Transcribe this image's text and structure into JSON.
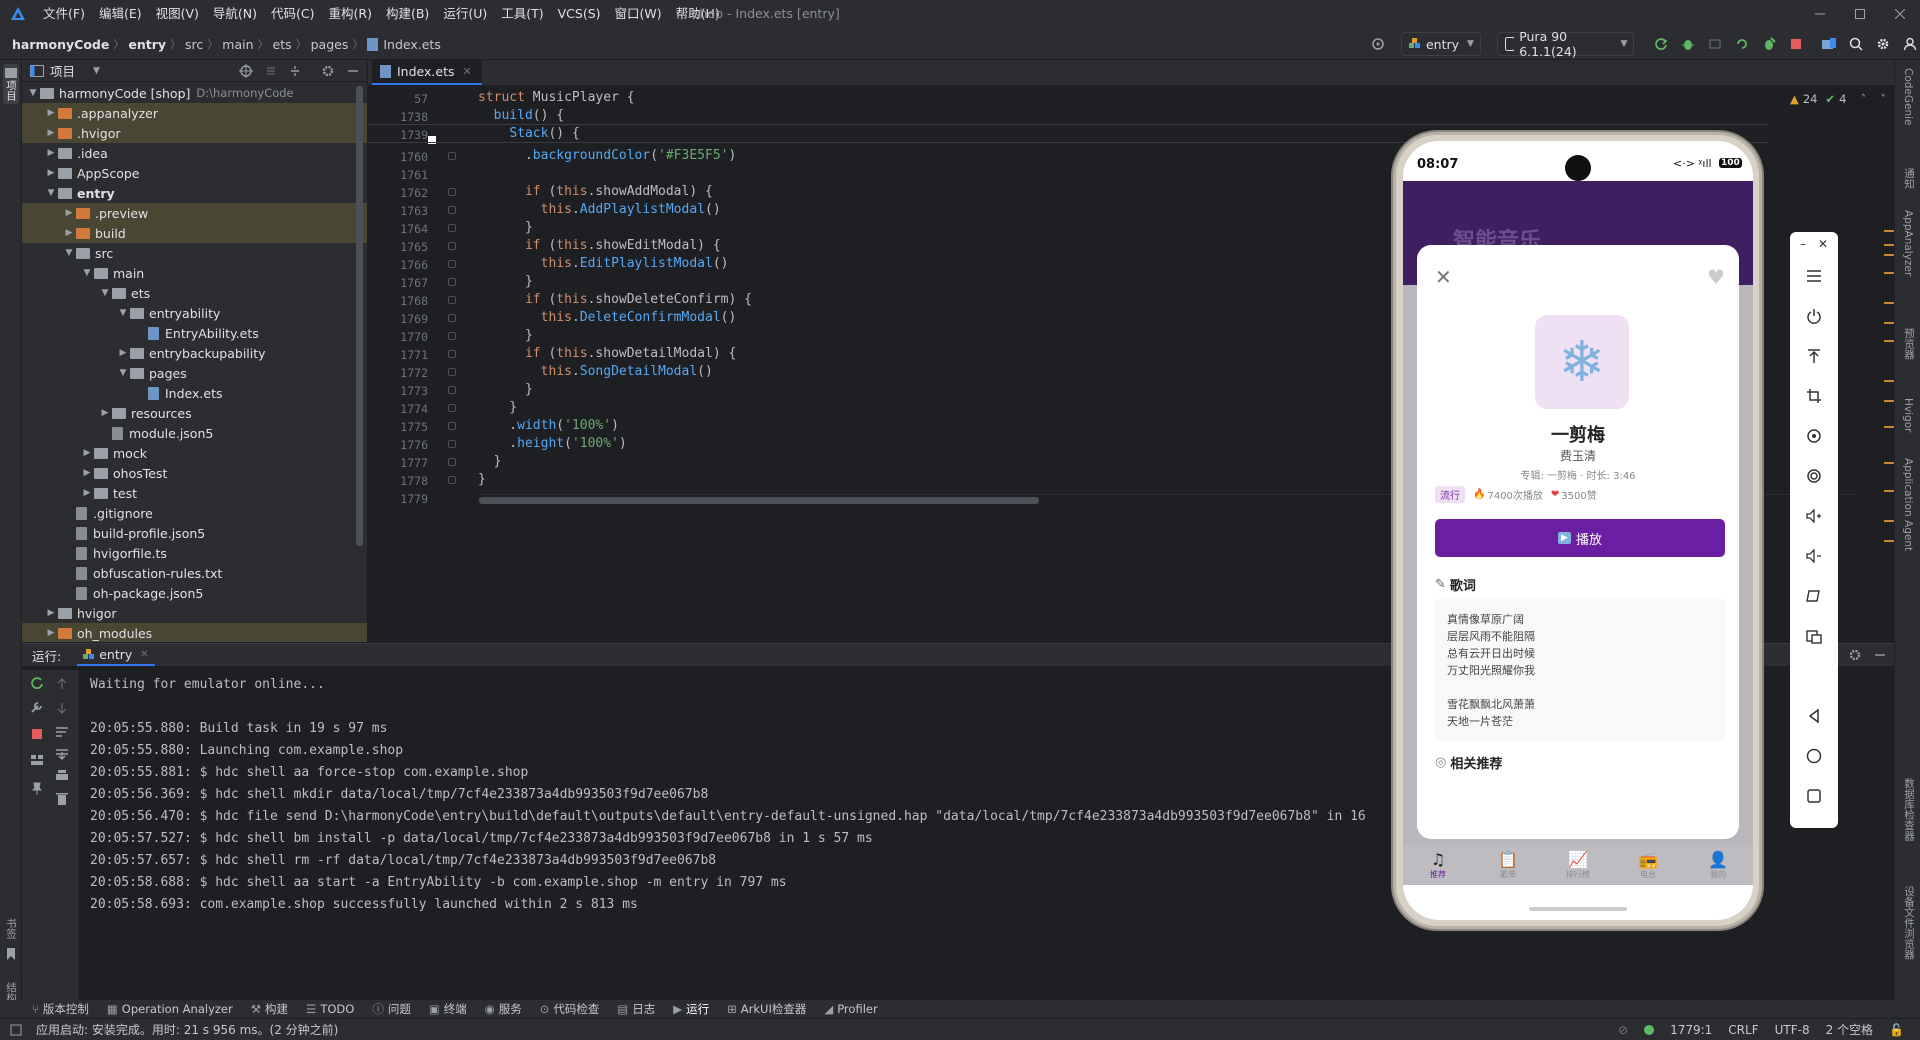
{
  "menu": {
    "items": [
      "文件(F)",
      "编辑(E)",
      "视图(V)",
      "导航(N)",
      "代码(C)",
      "重构(R)",
      "构建(B)",
      "运行(U)",
      "工具(T)",
      "VCS(S)",
      "窗口(W)",
      "帮助(H)"
    ],
    "window_title": "shop - Index.ets [entry]"
  },
  "toolbar": {
    "breadcrumb": [
      "harmonyCode",
      "entry",
      "src",
      "main",
      "ets",
      "pages",
      "Index.ets"
    ],
    "run_config": "entry",
    "device": "Pura 90 6.1.1(24)"
  },
  "project": {
    "header": "项目",
    "tree": [
      {
        "label": "harmonyCode [shop]",
        "extra": "D:\\harmonyCode",
        "depth": 0,
        "arrow": "down",
        "icon": "folder",
        "sel": false
      },
      {
        "label": ".appanalyzer",
        "depth": 1,
        "arrow": "right",
        "icon": "folder-orange",
        "sel": true
      },
      {
        "label": ".hvigor",
        "depth": 1,
        "arrow": "right",
        "icon": "folder-orange",
        "sel": true
      },
      {
        "label": ".idea",
        "depth": 1,
        "arrow": "right",
        "icon": "folder",
        "sel": false
      },
      {
        "label": "AppScope",
        "depth": 1,
        "arrow": "right",
        "icon": "folder",
        "sel": false
      },
      {
        "label": "entry",
        "depth": 1,
        "arrow": "down",
        "icon": "folder",
        "sel": false,
        "bold": true
      },
      {
        "label": ".preview",
        "depth": 2,
        "arrow": "right",
        "icon": "folder-orange",
        "sel": true
      },
      {
        "label": "build",
        "depth": 2,
        "arrow": "right",
        "icon": "folder-orange",
        "sel": true
      },
      {
        "label": "src",
        "depth": 2,
        "arrow": "down",
        "icon": "folder",
        "sel": false
      },
      {
        "label": "main",
        "depth": 3,
        "arrow": "down",
        "icon": "folder",
        "sel": false
      },
      {
        "label": "ets",
        "depth": 4,
        "arrow": "down",
        "icon": "folder",
        "sel": false
      },
      {
        "label": "entryability",
        "depth": 5,
        "arrow": "down",
        "icon": "folder",
        "sel": false
      },
      {
        "label": "EntryAbility.ets",
        "depth": 6,
        "arrow": "",
        "icon": "file",
        "sel": false
      },
      {
        "label": "entrybackupability",
        "depth": 5,
        "arrow": "right",
        "icon": "folder",
        "sel": false
      },
      {
        "label": "pages",
        "depth": 5,
        "arrow": "down",
        "icon": "folder",
        "sel": false
      },
      {
        "label": "Index.ets",
        "depth": 6,
        "arrow": "",
        "icon": "file",
        "sel": false
      },
      {
        "label": "resources",
        "depth": 4,
        "arrow": "right",
        "icon": "folder",
        "sel": false
      },
      {
        "label": "module.json5",
        "depth": 4,
        "arrow": "",
        "icon": "file-gray",
        "sel": false
      },
      {
        "label": "mock",
        "depth": 3,
        "arrow": "right",
        "icon": "folder",
        "sel": false
      },
      {
        "label": "ohosTest",
        "depth": 3,
        "arrow": "right",
        "icon": "folder",
        "sel": false
      },
      {
        "label": "test",
        "depth": 3,
        "arrow": "right",
        "icon": "folder",
        "sel": false
      },
      {
        "label": ".gitignore",
        "depth": 2,
        "arrow": "",
        "icon": "file-gray",
        "sel": false
      },
      {
        "label": "build-profile.json5",
        "depth": 2,
        "arrow": "",
        "icon": "file-gray",
        "sel": false
      },
      {
        "label": "hvigorfile.ts",
        "depth": 2,
        "arrow": "",
        "icon": "file-gray",
        "sel": false
      },
      {
        "label": "obfuscation-rules.txt",
        "depth": 2,
        "arrow": "",
        "icon": "file-gray",
        "sel": false
      },
      {
        "label": "oh-package.json5",
        "depth": 2,
        "arrow": "",
        "icon": "file-gray",
        "sel": false
      },
      {
        "label": "hvigor",
        "depth": 1,
        "arrow": "right",
        "icon": "folder",
        "sel": false
      },
      {
        "label": "oh_modules",
        "depth": 1,
        "arrow": "right",
        "icon": "folder-orange",
        "sel": true
      }
    ]
  },
  "editor": {
    "tab": "Index.ets",
    "warnings": "24",
    "checks": "4",
    "lines": [
      {
        "n": "57",
        "html": "<span class='kw'>struct</span> <span class='ty'>MusicPlayer</span> {"
      },
      {
        "n": "1738",
        "html": "  <span class='fn'>build</span>() {"
      },
      {
        "n": "1739",
        "html": "    <span class='fn'>Stack</span>() {"
      },
      {
        "n": "1760",
        "html": "      .<span class='fn'>backgroundColor</span>(<span class='str'>'#F3E5F5'</span>)"
      },
      {
        "n": "1761",
        "html": ""
      },
      {
        "n": "1762",
        "html": "      <span class='kw'>if</span> (<span class='kw'>this</span>.showAddModal) {"
      },
      {
        "n": "1763",
        "html": "        <span class='kw'>this</span>.<span class='fn'>AddPlaylistModal</span>()"
      },
      {
        "n": "1764",
        "html": "      }"
      },
      {
        "n": "1765",
        "html": "      <span class='kw'>if</span> (<span class='kw'>this</span>.showEditModal) {"
      },
      {
        "n": "1766",
        "html": "        <span class='kw'>this</span>.<span class='fn'>EditPlaylistModal</span>()"
      },
      {
        "n": "1767",
        "html": "      }"
      },
      {
        "n": "1768",
        "html": "      <span class='kw'>if</span> (<span class='kw'>this</span>.showDeleteConfirm) {"
      },
      {
        "n": "1769",
        "html": "        <span class='kw'>this</span>.<span class='fn'>DeleteConfirmModal</span>()"
      },
      {
        "n": "1770",
        "html": "      }"
      },
      {
        "n": "1771",
        "html": "      <span class='kw'>if</span> (<span class='kw'>this</span>.showDetailModal) {"
      },
      {
        "n": "1772",
        "html": "        <span class='kw'>this</span>.<span class='fn'>SongDetailModal</span>()"
      },
      {
        "n": "1773",
        "html": "      }"
      },
      {
        "n": "1774",
        "html": "    }"
      },
      {
        "n": "1775",
        "html": "    .<span class='fn'>width</span>(<span class='str'>'100%'</span>)"
      },
      {
        "n": "1776",
        "html": "    .<span class='fn'>height</span>(<span class='str'>'100%'</span>)"
      },
      {
        "n": "1777",
        "html": "  }"
      },
      {
        "n": "1778",
        "html": "}"
      },
      {
        "n": "1779",
        "html": ""
      }
    ]
  },
  "run": {
    "label": "运行:",
    "tab": "entry",
    "console": [
      "Waiting for emulator online...",
      "",
      "20:05:55.880: Build task in 19 s 97 ms",
      "20:05:55.880: Launching com.example.shop",
      "20:05:55.881: $ hdc shell aa force-stop com.example.shop",
      "20:05:56.369: $ hdc shell mkdir data/local/tmp/7cf4e233873a4db993503f9d7ee067b8",
      "20:05:56.470: $ hdc file send D:\\harmonyCode\\entry\\build\\default\\outputs\\default\\entry-default-unsigned.hap \"data/local/tmp/7cf4e233873a4db993503f9d7ee067b8\" in 16",
      "20:05:57.527: $ hdc shell bm install -p data/local/tmp/7cf4e233873a4db993503f9d7ee067b8 in 1 s 57 ms",
      "20:05:57.657: $ hdc shell rm -rf data/local/tmp/7cf4e233873a4db993503f9d7ee067b8",
      "20:05:58.688: $ hdc shell aa start -a EntryAbility -b com.example.shop -m entry in 797 ms",
      "20:05:58.693: com.example.shop successfully launched within 2 s 813 ms"
    ]
  },
  "bottom_tools": [
    "版本控制",
    "Operation Analyzer",
    "构建",
    "TODO",
    "问题",
    "终端",
    "服务",
    "代码检查",
    "日志",
    "运行",
    "ArkUI检查器",
    "Profiler"
  ],
  "status": {
    "message": "应用启动: 安装完成。用时: 21 s 956 ms。(2 分钟之前)",
    "position": "1779:1",
    "line_sep": "CRLF",
    "encoding": "UTF-8",
    "indent": "2 个空格"
  },
  "right_stripe": [
    "CodeGenie",
    "通知",
    "AppAnalyzer",
    "预览器",
    "Hvigor",
    "Application Agent",
    "数据库检查器",
    "设备文件浏览器"
  ],
  "left_stripe": [
    "项目",
    "书签",
    "结构"
  ],
  "phone": {
    "time": "08:07",
    "battery": "100",
    "header_title": "智能音乐",
    "song_title": "一剪梅",
    "artist": "费玉清",
    "album_info": "专辑: 一剪梅   · 时长: 3:46",
    "genre_tag": "流行",
    "plays": "7400次播放",
    "likes": "3500赞",
    "play_button": "播放",
    "lyrics_title": "歌词",
    "lyrics": [
      "真情像草原广阔",
      "层层风雨不能阻隔",
      "总有云开日出时候",
      "万丈阳光照耀你我",
      "",
      "雪花飘飘北风萧萧",
      "天地一片苍茫"
    ],
    "related_title": "相关推荐",
    "tabs": [
      "推荐",
      "歌单",
      "排行榜",
      "电台",
      "我的"
    ],
    "accent": "#6a1fa2"
  }
}
